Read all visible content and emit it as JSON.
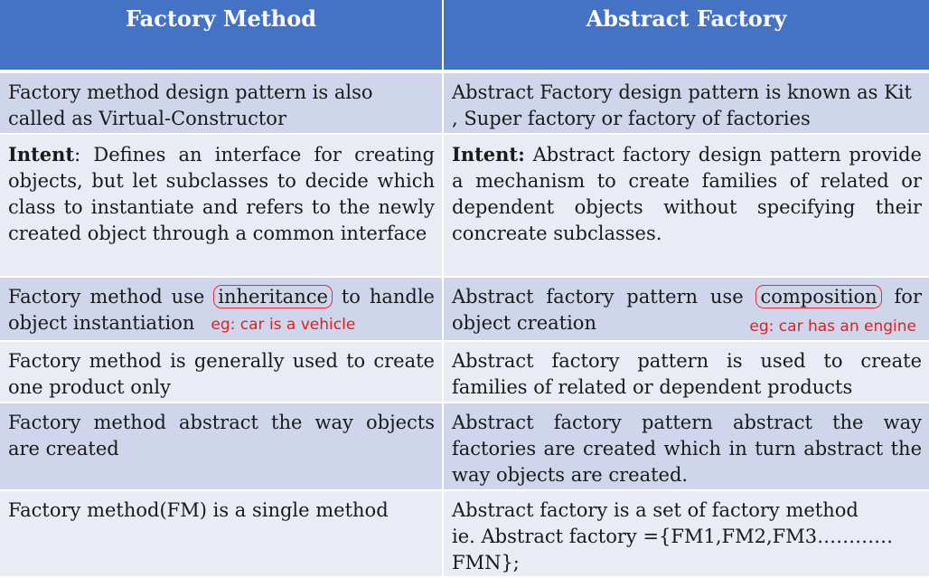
{
  "header": {
    "col1": "Factory Method",
    "col2": "Abstract Factory"
  },
  "rows": [
    {
      "left": "Factory method design pattern is also called as  Virtual-Constructor",
      "right": "Abstract Factory design pattern is known as Kit , Super factory or factory of factories"
    },
    {
      "left_label": "Intent",
      "left_text": ": Defines an interface for creating objects, but let subclasses to decide which class to instantiate and refers to the newly created object through a common interface",
      "right_label": "Intent:",
      "right_text": " Abstract factory design pattern provide a mechanism to create families of related or dependent objects without specifying their concreate subclasses."
    },
    {
      "left_pre": "Factory method use",
      "left_keyword": "inheritance",
      "left_post": "to handle",
      "left_line2": "object instantiation",
      "left_example": "eg: car is a vehicle",
      "right_pre": "Abstract factory  pattern use",
      "right_keyword": "composition",
      "right_post": "for",
      "right_line2": "object creation",
      "right_example": "eg: car has an engine"
    },
    {
      "left": "Factory method  is generally used to create one product only",
      "right": "Abstract factory  pattern is used to create families of related or dependent products"
    },
    {
      "left": "Factory method  abstract the way objects are created",
      "right": "Abstract factory  pattern abstract the way factories are created which in turn abstract the way objects are created."
    },
    {
      "left": "Factory method(FM) is a single method",
      "right_line1": "Abstract factory is a set of factory method",
      "right_line2": "ie. Abstract factory ={FM1,FM2,FM3…………FMN};"
    }
  ],
  "colors": {
    "header_bg": "#4472C4",
    "row_dark": "#CFD5EA",
    "row_light": "#E9EBF5",
    "annotation_red": "#E02020"
  }
}
